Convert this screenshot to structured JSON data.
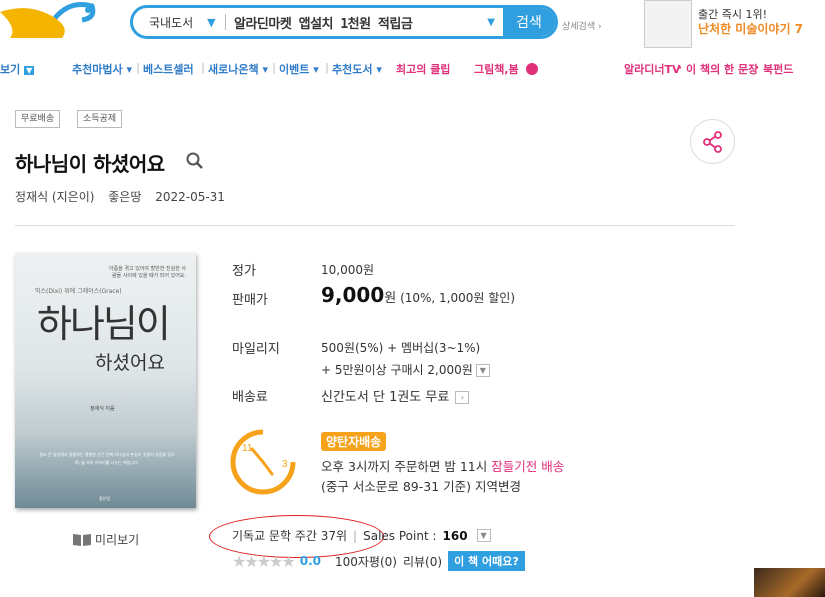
{
  "header": {
    "search_category": "국내도서",
    "search_query": "알라딘마켓 앱설치 1천원 적립금",
    "search_button": "검색",
    "advanced_search": "상세검색",
    "promo_line1": "출간 즉시 1위!",
    "promo_line2": "난처한 미술이야기 7"
  },
  "nav": {
    "left_cut": "보기",
    "items": [
      "추천마법사",
      "베스트셀러",
      "새로나온책",
      "이벤트",
      "추천도서"
    ],
    "pink_items": [
      "최고의 클립",
      "그림책,봄"
    ],
    "right_links": [
      "알라디너TV",
      "이 책의 한 문장",
      "북펀드"
    ]
  },
  "product": {
    "tags": [
      "무료배송",
      "소득공제"
    ],
    "title": "하나님이 하셨어요",
    "author": "정재식 (지은이)",
    "publisher": "좋은땅",
    "date": "2022-05-31",
    "preview_label": "미리보기",
    "cover": {
      "small_top": "아픔을 겪고 있어야 할만한 진실한 사람들 사이에 있을 때가 되어 있어요.",
      "subtitle": "믹스(Dixi) 위에 그레이스(Grace)",
      "title_main": "하나님이",
      "title_sub": "하셨어요",
      "author": "정재식 지음",
      "blurb": "결코 큰 일상에서 경험하는 평범한 순간 안에 하나님의 손길이 깃들어 있음을 믿으며, 삶 속의 이야기를 나누는 책입니다.",
      "publisher": "좋은땅"
    }
  },
  "info": {
    "list_price_label": "정가",
    "list_price": "10,000원",
    "sale_price_label": "판매가",
    "sale_price": "9,000",
    "sale_price_unit": "원",
    "sale_discount": "(10%, 1,000원 할인)",
    "mileage_label": "마일리지",
    "mileage_line1": "500원(5%) + 멤버십(3~1%)",
    "mileage_line2": "+ 5만원이상 구매시 2,000원",
    "shipping_label": "배송료",
    "shipping_value": "신간도서 단 1권도 무료",
    "delivery_badge": "양탄자배송",
    "delivery_line1a": "오후 3시까지 주문하면 밤 11시 ",
    "delivery_line1b": "잠들기전 배송",
    "delivery_line2a": "(중구 서소문로 89-31 기준) ",
    "delivery_line2b": "지역변경",
    "clock_11": "11",
    "clock_3": "3",
    "rank_text": "기독교 문학 주간 37위",
    "sales_point_label": "Sales Point :",
    "sales_point": "160",
    "rating": "0.0",
    "short_review": "100자평(0)",
    "review": "리뷰(0)",
    "ask_button": "이 책 어때요?"
  },
  "colors": {
    "accent_blue": "#2f9fe0",
    "pink": "#e0307a",
    "orange": "#f7a21b",
    "annotation_red": "#e02020"
  }
}
